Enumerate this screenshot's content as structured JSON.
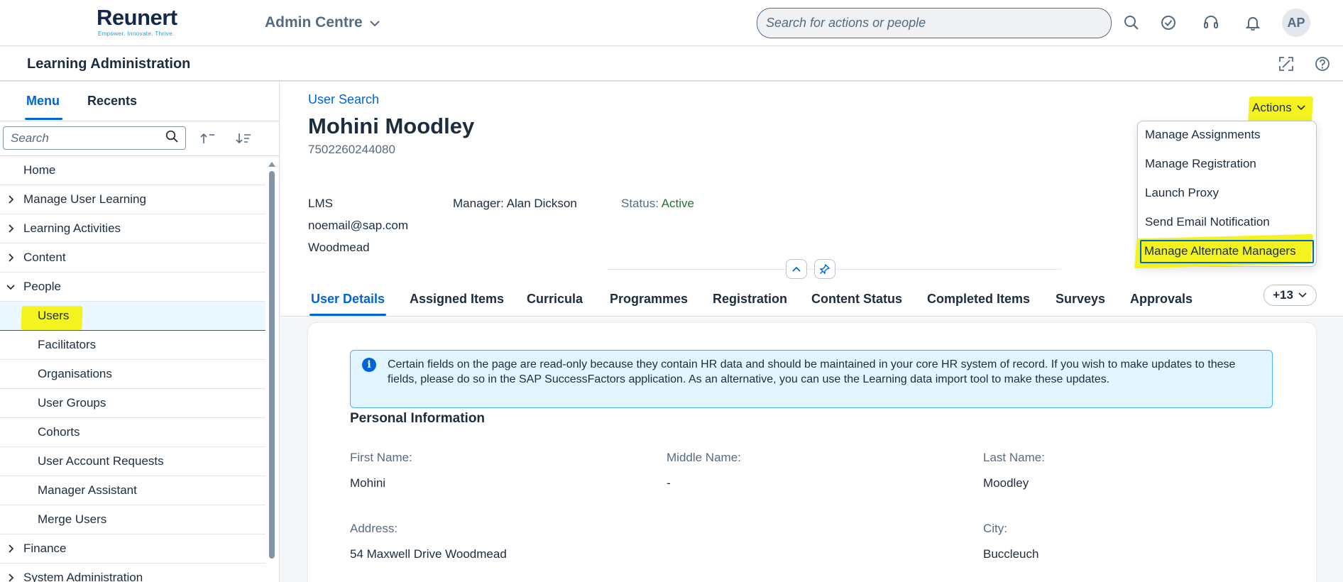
{
  "brand": {
    "logo_text": "Reunert",
    "tagline": "Empower. Innovate. Thrive."
  },
  "shell": {
    "app_title": "Admin Centre",
    "search_placeholder": "Search for actions or people",
    "avatar_initials": "AP"
  },
  "subheader": {
    "title": "Learning Administration"
  },
  "nav": {
    "tabs": [
      "Menu",
      "Recents"
    ],
    "search_placeholder": "Search",
    "items": [
      {
        "label": "Home",
        "level": 0,
        "expandable": false
      },
      {
        "label": "Manage User Learning",
        "level": 0,
        "expandable": true
      },
      {
        "label": "Learning Activities",
        "level": 0,
        "expandable": true
      },
      {
        "label": "Content",
        "level": 0,
        "expandable": true
      },
      {
        "label": "People",
        "level": 0,
        "expandable": true,
        "expanded": true
      },
      {
        "label": "Users",
        "level": 1,
        "selected": true
      },
      {
        "label": "Facilitators",
        "level": 1
      },
      {
        "label": "Organisations",
        "level": 1
      },
      {
        "label": "User Groups",
        "level": 1
      },
      {
        "label": "Cohorts",
        "level": 1
      },
      {
        "label": "User Account Requests",
        "level": 1
      },
      {
        "label": "Manager Assistant",
        "level": 1
      },
      {
        "label": "Merge Users",
        "level": 1
      },
      {
        "label": "Finance",
        "level": 0,
        "expandable": true
      },
      {
        "label": "System Administration",
        "level": 0,
        "expandable": true
      }
    ]
  },
  "user": {
    "breadcrumb": "User Search",
    "name": "Mohini Moodley",
    "id": "7502260244080",
    "type": "LMS",
    "email": "noemail@sap.com",
    "location": "Woodmead",
    "manager_label": "Manager:",
    "manager_name": "Alan Dickson",
    "status_label": "Status:",
    "status_value": "Active"
  },
  "actions": {
    "label": "Actions",
    "menu": [
      "Manage Assignments",
      "Manage Registration",
      "Launch Proxy",
      "Send Email Notification",
      "Manage Alternate Managers"
    ]
  },
  "tabs": {
    "items": [
      "User Details",
      "Assigned Items",
      "Curricula",
      "Programmes",
      "Registration",
      "Content Status",
      "Completed Items",
      "Surveys",
      "Approvals"
    ],
    "more": "+13"
  },
  "details": {
    "info_text": "Certain fields on the page are read-only because they contain HR data and should be maintained in your core HR system of record. If you wish to make updates to these fields, please do so in the SAP SuccessFactors application. As an alternative, you can use the Learning data import tool to make these updates.",
    "section_title": "Personal Information",
    "first_name_label": "First Name:",
    "first_name": "Mohini",
    "middle_name_label": "Middle Name:",
    "middle_name": "-",
    "last_name_label": "Last Name:",
    "last_name": "Moodley",
    "address_label": "Address:",
    "address": "54 Maxwell Drive Woodmead",
    "city_label": "City:",
    "city": "Buccleuch"
  },
  "colors": {
    "brand_blue": "#0064d9",
    "highlight": "#f4f320",
    "status_green": "#256f3a"
  }
}
